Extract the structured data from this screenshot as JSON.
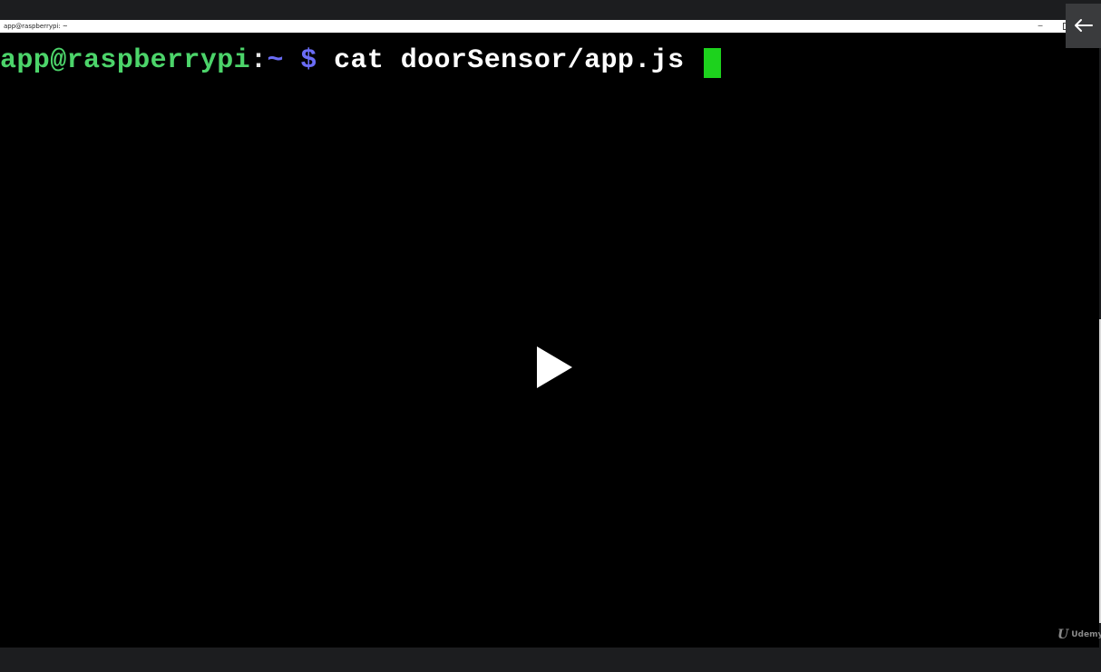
{
  "window": {
    "title": "app@raspberrypi: ~",
    "minimize_glyph": "─",
    "maximize_glyph": ""
  },
  "terminal": {
    "prompt_user_host": "app@raspberrypi",
    "prompt_colon": ":",
    "prompt_path": "~",
    "prompt_symbol": "$",
    "command": "cat doorSensor/app.js"
  },
  "player": {
    "play_icon": "play-icon",
    "back_icon": "arrow-left-icon",
    "watermark_logo": "U",
    "watermark_text": "Udemy"
  },
  "colors": {
    "prompt_user": "#4cd46a",
    "prompt_path": "#6a6cf5",
    "cursor": "#1dd21d",
    "background": "#000000"
  }
}
